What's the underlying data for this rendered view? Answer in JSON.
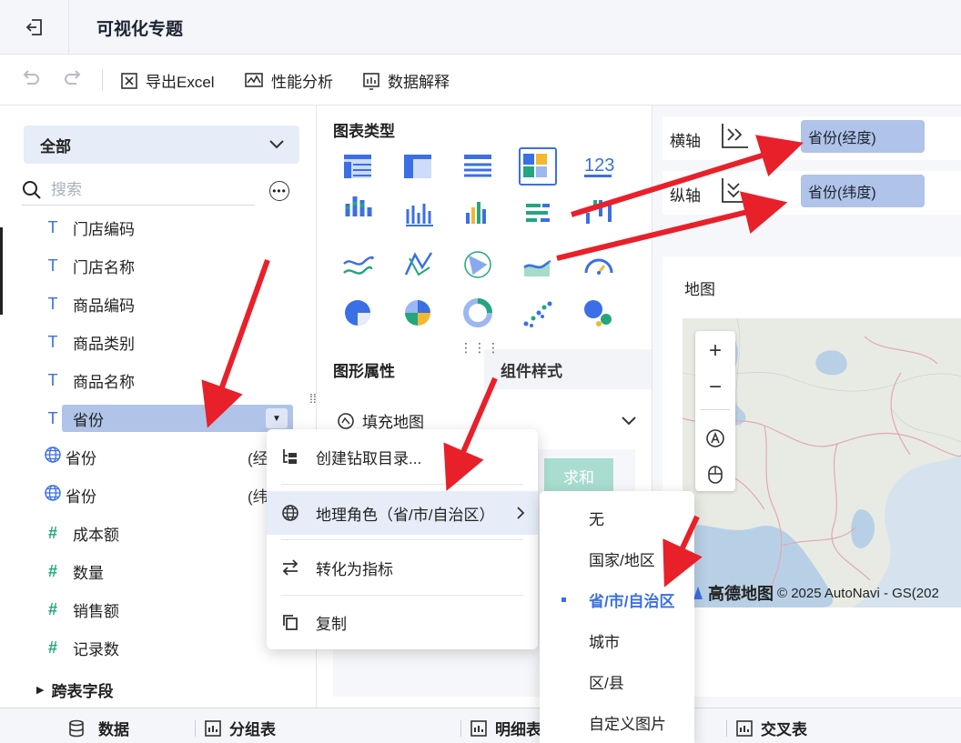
{
  "header": {
    "title": "可视化专题",
    "back_icon": "exit-icon"
  },
  "toolbar": {
    "export_label": "导出Excel",
    "perf_label": "性能分析",
    "explain_label": "数据解释"
  },
  "left": {
    "scope": "全部",
    "search_placeholder": "搜索",
    "fields": [
      {
        "type": "text",
        "label": "门店编码"
      },
      {
        "type": "text",
        "label": "门店名称"
      },
      {
        "type": "text",
        "label": "商品编码"
      },
      {
        "type": "text",
        "label": "商品类别"
      },
      {
        "type": "text",
        "label": "商品名称"
      },
      {
        "type": "text",
        "label": "省份"
      },
      {
        "type": "geo",
        "label": "省份",
        "suffix": "(经"
      },
      {
        "type": "geo",
        "label": "省份",
        "suffix": "(纬"
      },
      {
        "type": "number",
        "label": "成本额"
      },
      {
        "type": "number",
        "label": "数量"
      },
      {
        "type": "number",
        "label": "销售额"
      },
      {
        "type": "number",
        "label": "记录数"
      }
    ],
    "cross_table": "跨表字段"
  },
  "mid": {
    "chart_type_title": "图表类型",
    "number_chart_label": "123",
    "tab_shape": "图形属性",
    "tab_style": "组件样式",
    "fill_map": "填充地图",
    "sum": "求和"
  },
  "right": {
    "x_axis_label": "横轴",
    "y_axis_label": "纵轴",
    "x_axis_value": "省份(经度)",
    "y_axis_value": "省份(纬度)",
    "map_title": "地图",
    "zoom_in": "+",
    "zoom_out": "−",
    "attribution_brand": "高德地图",
    "attribution_text": "© 2025 AutoNavi - GS(202"
  },
  "context_menu": {
    "drill": "创建钻取目录...",
    "geo_role": "地理角色（省/市/自治区）",
    "to_metric": "转化为指标",
    "copy": "复制"
  },
  "submenu": {
    "items": [
      "无",
      "国家/地区",
      "省/市/自治区",
      "城市",
      "区/县",
      "自定义图片"
    ],
    "selected": "省/市/自治区"
  },
  "bottom": {
    "data": "数据",
    "group_table": "分组表",
    "detail_table": "明细表",
    "cross_table": "交叉表"
  },
  "colors": {
    "accent": "#3a6fe6",
    "pill": "#b0c3e8",
    "arrow": "#e8202a",
    "number_field": "#23a67e"
  }
}
